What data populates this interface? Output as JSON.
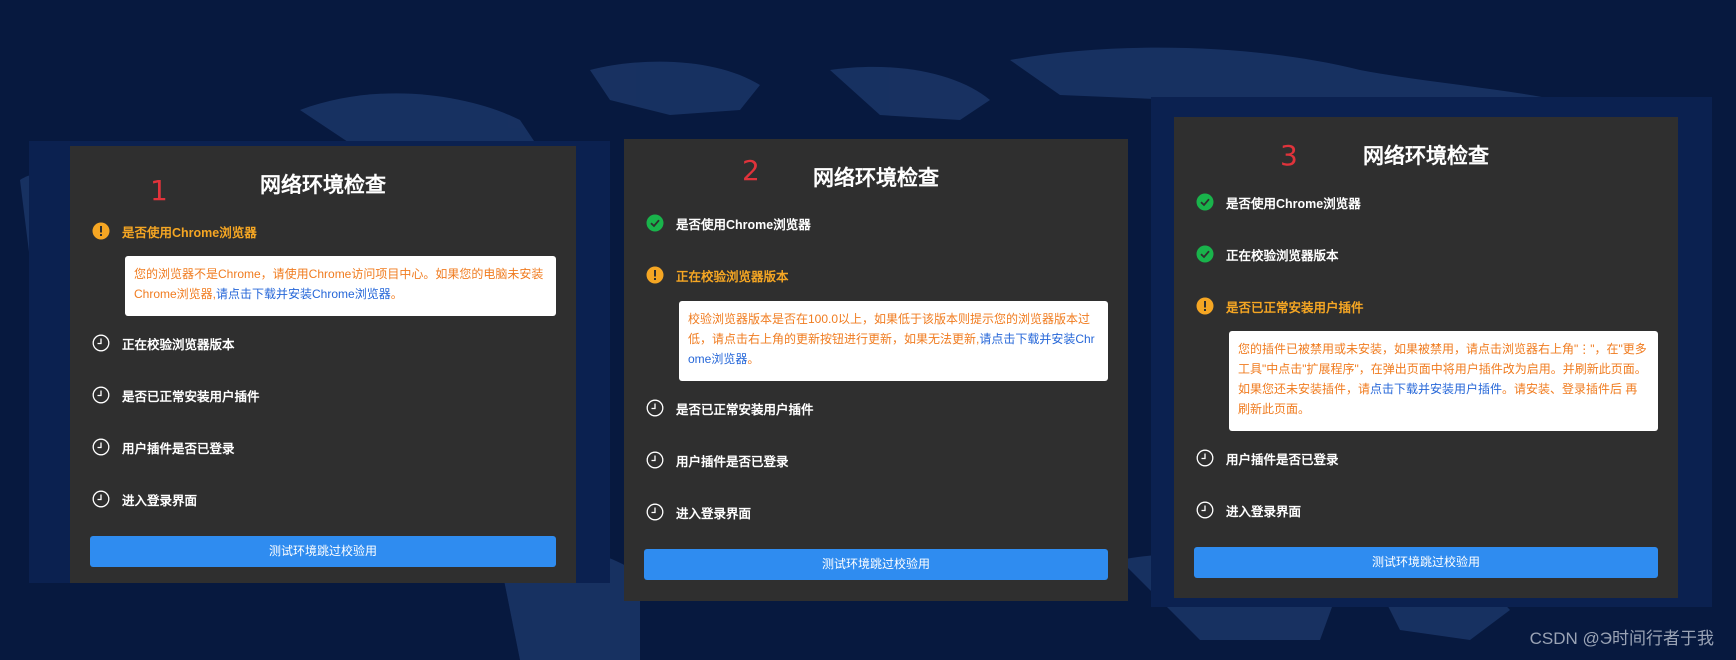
{
  "title": "网络环境检查",
  "skip_button": "测试环境跳过校验用",
  "watermark": "CSDN @Э时间行者于我",
  "colors": {
    "bg": "#07193f",
    "panel": "#2f2f2f",
    "warn": "#f5a623",
    "ok": "#19b34b",
    "button": "#2f8cf0",
    "number": "#e0333b",
    "link": "#2667d8",
    "msg_text": "#f07c20"
  },
  "icons": {
    "done": "check-circle-icon",
    "warning": "exclamation-circle-icon",
    "pending": "clock-icon"
  },
  "panels": [
    {
      "number": "1",
      "steps": [
        {
          "label": "是否使用Chrome浏览器",
          "status": "warning"
        },
        {
          "label": "正在校验浏览器版本",
          "status": "pending"
        },
        {
          "label": "是否已正常安装用户插件",
          "status": "pending"
        },
        {
          "label": "用户插件是否已登录",
          "status": "pending"
        },
        {
          "label": "进入登录界面",
          "status": "pending"
        }
      ],
      "message": {
        "line1": "您的浏览器不是Chrome，请使用Chrome访问项目中心。如果您的电脑未安装",
        "line2_a": "Chrome浏览器,",
        "line2_link": "请点击下载并安装Chrome浏览器",
        "line2_b": "。"
      }
    },
    {
      "number": "2",
      "steps": [
        {
          "label": "是否使用Chrome浏览器",
          "status": "done"
        },
        {
          "label": "正在校验浏览器版本",
          "status": "warning"
        },
        {
          "label": "是否已正常安装用户插件",
          "status": "pending"
        },
        {
          "label": "用户插件是否已登录",
          "status": "pending"
        },
        {
          "label": "进入登录界面",
          "status": "pending"
        }
      ],
      "message": {
        "line1": "校验浏览器版本是否在100.0以上，如果低于该版本则提示您的浏览器版本过",
        "line2_a": "低，请点击右上角的更新按钮进行更新，如果无法更新,",
        "line2_link": "请点击下载并安装Chr",
        "line3_link": "ome浏览器",
        "line3_b": "。"
      }
    },
    {
      "number": "3",
      "steps": [
        {
          "label": "是否使用Chrome浏览器",
          "status": "done"
        },
        {
          "label": "正在校验浏览器版本",
          "status": "done"
        },
        {
          "label": "是否已正常安装用户插件",
          "status": "warning"
        },
        {
          "label": "用户插件是否已登录",
          "status": "pending"
        },
        {
          "label": "进入登录界面",
          "status": "pending"
        }
      ],
      "message": {
        "line1": "您的插件已被禁用或未安装，如果被禁用，请点击浏览器右上角\"⋮\"，在\"更多",
        "line2": "工具\"中点击\"扩展程序\"，在弹出页面中将用户插件改为启用。并刷新此页面。",
        "line3_a": "如果您还未安装插件，请",
        "line3_link": "点击下载并安装用户插件",
        "line3_b": "。请安装、登录插件后 再",
        "line4": "刷新此页面。"
      }
    }
  ]
}
